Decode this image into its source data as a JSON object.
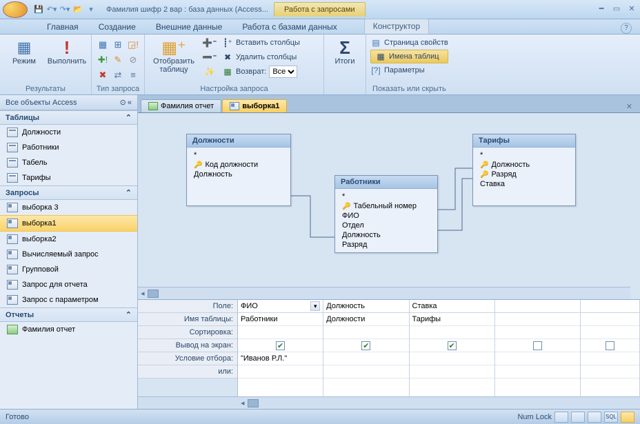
{
  "window": {
    "title": "Фамилия шифр 2 вар : база данных (Access...",
    "context_title": "Работа с запросами"
  },
  "qat": {
    "save": "💾"
  },
  "tabs": {
    "home": "Главная",
    "create": "Создание",
    "external": "Внешние данные",
    "dbtools": "Работа с базами данных",
    "designer": "Конструктор"
  },
  "ribbon": {
    "results": {
      "view": "Режим",
      "run": "Выполнить",
      "label": "Результаты"
    },
    "qtype_label": "Тип запроса",
    "setup": {
      "show_table": "Отобразить таблицу",
      "insert_cols": "Вставить столбцы",
      "delete_cols": "Удалить столбцы",
      "return": "Возврат:",
      "return_val": "Все",
      "label": "Настройка запроса"
    },
    "totals": {
      "btn": "Итоги"
    },
    "showhide": {
      "propsheet": "Страница свойств",
      "tablenames": "Имена таблиц",
      "params": "Параметры",
      "label": "Показать или скрыть"
    }
  },
  "nav": {
    "header": "Все объекты Access",
    "sec_tables": "Таблицы",
    "tables": [
      "Должности",
      "Работники",
      "Табель",
      "Тарифы"
    ],
    "sec_queries": "Запросы",
    "queries": [
      "выборка 3",
      "выборка1",
      "выборка2",
      "Вычисляемый запрос",
      "Групповой",
      "Запрос для отчета",
      "Запрос с параметром"
    ],
    "sec_reports": "Отчеты",
    "reports": [
      "Фамилия отчет"
    ]
  },
  "doc_tabs": {
    "t1": "Фамилия отчет",
    "t2": "выборка1"
  },
  "diagram": {
    "t1": {
      "title": "Должности",
      "star": "*",
      "f1": "Код должности",
      "f2": "Должность"
    },
    "t2": {
      "title": "Работники",
      "star": "*",
      "f1": "Табельный номер",
      "f2": "ФИО",
      "f3": "Отдел",
      "f4": "Должность",
      "f5": "Разряд"
    },
    "t3": {
      "title": "Тарифы",
      "star": "*",
      "f1": "Должность",
      "f2": "Разряд",
      "f3": "Ставка"
    }
  },
  "grid": {
    "labels": {
      "field": "Поле:",
      "table": "Имя таблицы:",
      "sort": "Сортировка:",
      "show": "Вывод на экран:",
      "criteria": "Условие отбора:",
      "or": "или:"
    },
    "c1": {
      "field": "ФИО",
      "table": "Работники",
      "criteria": "\"Иванов Р.Л.\""
    },
    "c2": {
      "field": "Должность",
      "table": "Должности"
    },
    "c3": {
      "field": "Ставка",
      "table": "Тарифы"
    }
  },
  "status": {
    "ready": "Готово",
    "numlock": "Num Lock"
  }
}
